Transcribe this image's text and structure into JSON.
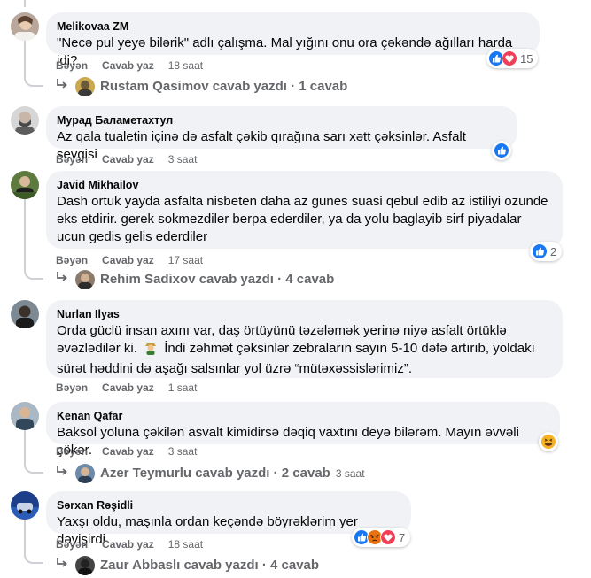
{
  "comments": [
    {
      "author": "Melikovaa ZM",
      "text": "\"Necə pul yeyə bilərik\" adlı çalışma. Mal yığını onu ora çəkəndə ağılları harda idi?",
      "like_label": "Bəyən",
      "reply_label": "Cavab yaz",
      "time": "18 saat",
      "reaction_count": "15",
      "reactions": [
        "like-icon",
        "love-icon"
      ],
      "replies_text": "Rustam Qasimov cavab yazdı · 1 cavab"
    },
    {
      "author": "Мурад Баламетахтул",
      "text": "Az qala tualetin içinə də asfalt çəkib qırağına sarı xətt çəksinlər. Asfalt sevgisi",
      "like_label": "Bəyən",
      "reply_label": "Cavab yaz",
      "time": "3 saat",
      "reactions": [
        "like-icon"
      ]
    },
    {
      "author": "Javid Mikhailov",
      "text": "Dash ortuk yayda asfalta nisbeten daha az gunes suasi qebul edib az istiliyi ozunde eks etdirir. gerek sokmezdiler berpa ederdiler, ya da yolu baglayib sirf piyadalar ucun gedis gelis ederdiler",
      "like_label": "Bəyən",
      "reply_label": "Cavab yaz",
      "time": "17 saat",
      "reaction_count": "2",
      "reactions": [
        "like-icon"
      ],
      "replies_text": "Rehim Sadixov cavab yazdı · 4 cavab"
    },
    {
      "author": "Nurlan Ilyas",
      "text_line1": "Orda güclü insan axını var, daş örtüyünü təzələmək yerinə niyə asfalt örtüklə",
      "text_line2a": "əvəzlədilər ki.",
      "text_line2b": "İndi zəhmət çəksinlər zebraların sayın 5-10 dəfə artırıb, yoldakı",
      "text_line3": "sürət həddini də aşağı salsınlar yol üzrə “mütəxəssislərimiz”.",
      "like_label": "Bəyən",
      "reply_label": "Cavab yaz",
      "time": "1 saat"
    },
    {
      "author": "Kenan Qafar",
      "text": "Baksol yoluna çəkilən asvalt kimidirsə dəqiq vaxtını deyə bilərəm. Mayın əvvəli çökər.",
      "like_label": "Bəyən",
      "reply_label": "Cavab yaz",
      "time": "3 saat",
      "reactions": [
        "haha-icon"
      ],
      "replies_text": "Azer Teymurlu cavab yazdı · 2 cavab",
      "replies_time": "3 saat"
    },
    {
      "author": "Sərxan Rəşidli",
      "text": "Yaxşı oldu, maşınla ordan keçəndə böyrəklərim yer dəyişirdi",
      "like_label": "Bəyən",
      "reply_label": "Cavab yaz",
      "time": "18 saat",
      "reaction_count": "7",
      "reactions": [
        "like-icon",
        "angry-icon",
        "love-icon"
      ],
      "replies_text": "Zaur Abbaslı cavab yazdı · 4 cavab"
    }
  ],
  "colors": {
    "bubble": "#f0f2f5",
    "secondary_text": "#65676b",
    "like_blue": "#1877f2",
    "love_red": "#f33e58",
    "haha_yellow": "#f7b125",
    "angry_orange": "#e9710f"
  }
}
